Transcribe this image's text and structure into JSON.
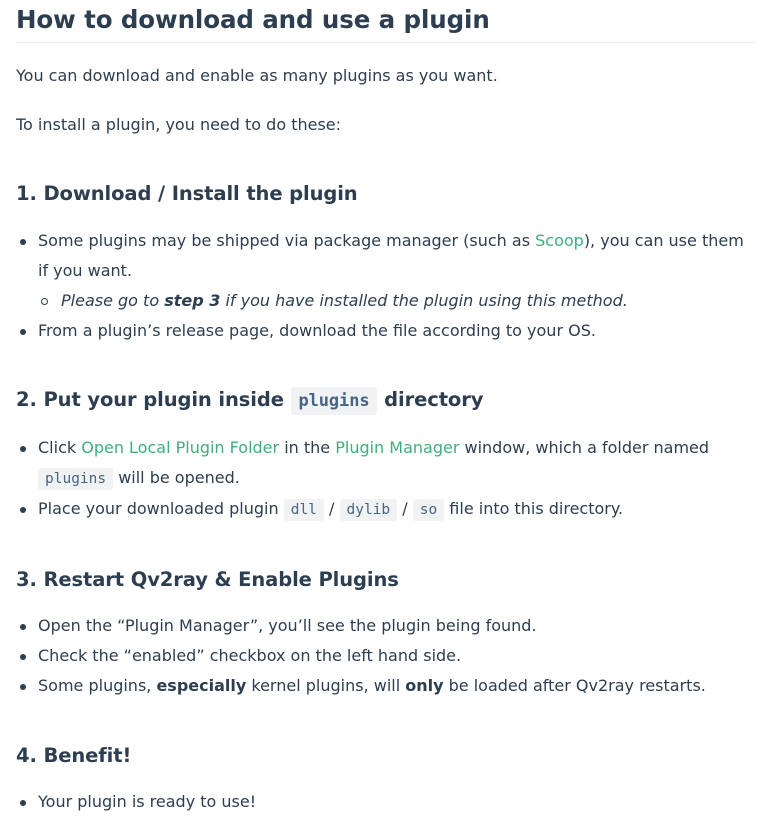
{
  "title": "How to download and use a plugin",
  "intro": [
    "You can download and enable as many plugins as you want.",
    "To install a plugin, you need to do these:"
  ],
  "sections": {
    "s1": {
      "heading": "1. Download / Install the plugin",
      "item1_a": "Some plugins may be shipped via package manager (such as ",
      "item1_link": "Scoop",
      "item1_b": "), you can use them if you want.",
      "sub_a": "Please go to ",
      "sub_bold": "step 3",
      "sub_b": " if you have installed the plugin using this method.",
      "item2": "From a plugin’s release page, download the file according to your OS."
    },
    "s2": {
      "heading_a": "2. Put your plugin inside ",
      "heading_code": "plugins",
      "heading_b": " directory",
      "item1_a": "Click ",
      "item1_link1": "Open Local Plugin Folder",
      "item1_b": " in the ",
      "item1_link2": "Plugin Manager",
      "item1_c": " window, which a folder named ",
      "item1_code": "plugins",
      "item1_d": " will be opened.",
      "item2_a": "Place your downloaded plugin ",
      "code_dll": "dll",
      "slash": "/",
      "code_dylib": "dylib",
      "code_so": "so",
      "item2_b": " file into this directory."
    },
    "s3": {
      "heading": "3. Restart Qv2ray & Enable Plugins",
      "item1": "Open the “Plugin Manager”, you’ll see the plugin being found.",
      "item2": "Check the “enabled” checkbox on the left hand side.",
      "item3_a": "Some plugins, ",
      "item3_bold1": "especially",
      "item3_b": " kernel plugins, will ",
      "item3_bold2": "only",
      "item3_c": " be loaded after Qv2ray restarts."
    },
    "s4": {
      "heading": "4. Benefit!",
      "item1": "Your plugin is ready to use!"
    }
  },
  "colors": {
    "text": "#2c3e50",
    "link": "#3eaf7c",
    "code_bg": "#f0f2f4",
    "code_text": "#476582"
  }
}
